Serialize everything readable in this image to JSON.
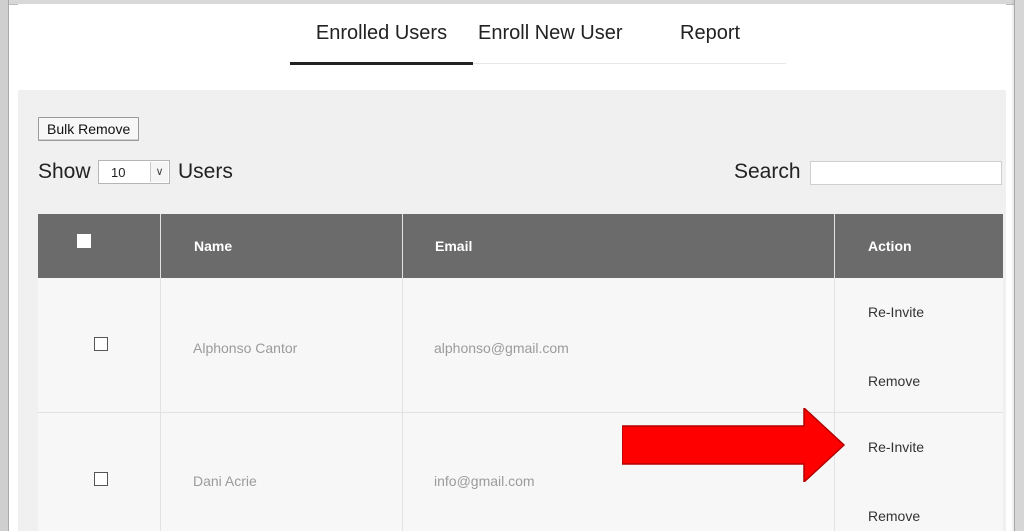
{
  "tabs": [
    {
      "label": "Enrolled Users",
      "active": true
    },
    {
      "label": "Enroll New User",
      "active": false
    },
    {
      "label": "Report",
      "active": false
    }
  ],
  "toolbar": {
    "bulk_remove_label": "Bulk Remove",
    "show_label": "Show",
    "page_size_value": "10",
    "users_label": "Users",
    "search_label": "Search",
    "search_value": ""
  },
  "table": {
    "headers": {
      "name": "Name",
      "email": "Email",
      "action": "Action"
    },
    "rows": [
      {
        "name": "Alphonso Cantor",
        "email": "alphonso@gmail.com",
        "reinvite": "Re-Invite",
        "remove": "Remove"
      },
      {
        "name": "Dani Acrie",
        "email": "info@gmail.com",
        "reinvite": "Re-Invite",
        "remove": "Remove"
      }
    ]
  },
  "annotation": {
    "arrow_color": "#ff0000",
    "arrow_stroke": "#b30000"
  },
  "colors": {
    "header_bg": "#6b6b6b",
    "content_bg": "#f0f0f0"
  }
}
